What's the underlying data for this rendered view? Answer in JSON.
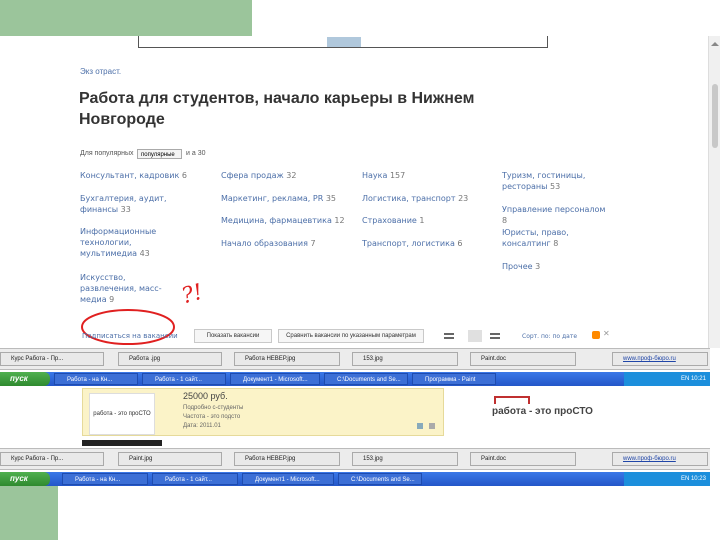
{
  "page": {
    "breadcrumb": "Экз отраст.",
    "title_line1": "Работа для студентов, начало карьеры в Нижнем",
    "title_line2": "Новгороде",
    "sort_label": "Для популярных",
    "sort_value": "популярные",
    "sort_extra": "и а 30",
    "col1": [
      {
        "label": "Консультант, кадровик",
        "count": "6"
      },
      {
        "label": "Бухгалтерия, аудит, финансы",
        "count": "33"
      },
      {
        "label": "Информационные технологии, мультимедиа",
        "count": "43"
      },
      {
        "label": "Искусство, развлечения, масс-медиа",
        "count": "9"
      }
    ],
    "col2": [
      {
        "label": "Сфера продаж",
        "count": "32"
      },
      {
        "label": "Маркетинг, реклама, PR",
        "count": "35"
      },
      {
        "label": "Медицина, фармацевтика",
        "count": "12"
      },
      {
        "label": "Начало образования",
        "count": "7"
      }
    ],
    "col3": [
      {
        "label": "Наука",
        "count": "157"
      },
      {
        "label": "Логистика, транспорт",
        "count": "23"
      },
      {
        "label": "Страхование",
        "count": "1"
      },
      {
        "label": "Транспорт, логистика",
        "count": "6"
      }
    ],
    "col4": [
      {
        "label": "Туризм, гостиницы, рестораны",
        "count": "53"
      },
      {
        "label": "Управление персоналом",
        "count": "8"
      },
      {
        "label": "Юристы, право, консалтинг",
        "count": "8"
      },
      {
        "label": "Прочее",
        "count": "3"
      }
    ],
    "subscribe_link": "Подписаться на вакансии",
    "filter_button_1": "Показать вакансии",
    "filter_button_2": "Сравнить вакансии по указанным параметрам",
    "right_controls": "Сорт. по: по дате"
  },
  "annotation": {
    "scribble_text": "?!"
  },
  "taskbar_top": {
    "start_label": "пуск",
    "items": [
      "Работа - на Кн...",
      "Работа - 1 сайт...",
      "Документ1 - Microsoft...",
      "C:\\Documents and Se...",
      "Программа - Paint"
    ],
    "tray_text": "EN 10:21"
  },
  "windows_bar_top": {
    "items": [
      "Курс Работа - Пр...",
      "Работа .jpg",
      "Работа НЕВЕР.jpg",
      "153.jpg",
      "Paint.doc"
    ],
    "right_text": "www.проф-бюро.ru"
  },
  "lower_content": {
    "salary": "25000 руб.",
    "line1": "Подробно с-студенты",
    "line2": "Частота - это подсто",
    "line3": "Дата: 2011.01",
    "logo_text": "работа - это проСТО",
    "logo_small": "работа - это проСТО"
  },
  "taskbar_bottom": {
    "start_label": "пуск",
    "items": [
      "Работа - на Кн...",
      "Работа - 1 сайт...",
      "Документ1 - Microsoft...",
      "C:\\Documents and Se..."
    ],
    "tray_text": "EN 10:23"
  },
  "windows_bar_bottom": {
    "items": [
      "Курс Работа - Пр...",
      "Paint.jpg",
      "Работа НЕВЕР.jpg",
      "153.jpg",
      "Paint.doc"
    ],
    "right_text": "www.проф-бюро.ru"
  },
  "colors": {
    "green_decor": "#9bc59b",
    "link_blue": "#4c6fa8",
    "annotation_red": "#e02020",
    "xp_blue": "#2d62d8"
  }
}
